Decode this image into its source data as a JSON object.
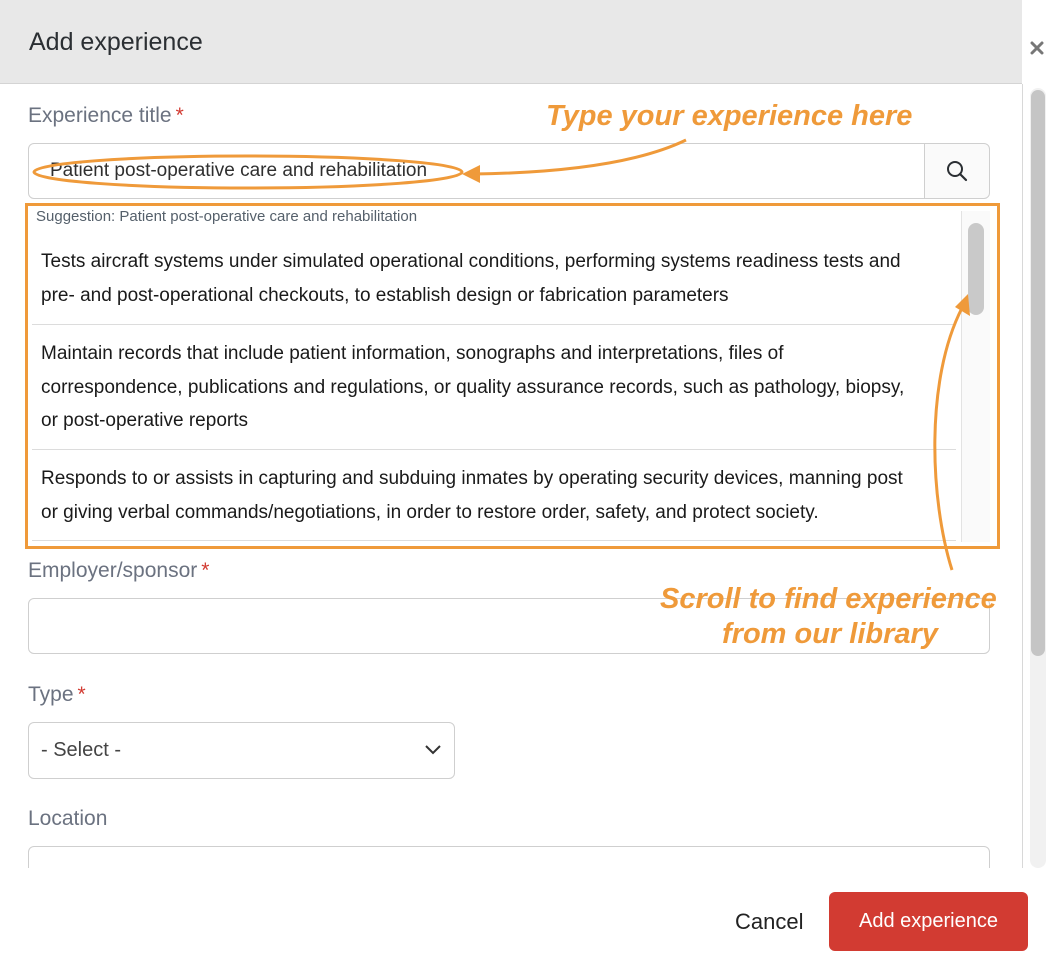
{
  "dialog": {
    "title": "Add experience"
  },
  "form": {
    "experience_title": {
      "label": "Experience title",
      "required_mark": "*",
      "value": "Patient post-operative care and rehabilitation"
    },
    "employer": {
      "label": "Employer/sponsor",
      "required_mark": "*",
      "value": ""
    },
    "type": {
      "label": "Type",
      "required_mark": "*",
      "selected": "- Select -"
    },
    "location": {
      "label": "Location",
      "value": ""
    }
  },
  "suggestions": {
    "header": "Suggestion: Patient post-operative care and rehabilitation",
    "items": [
      {
        "lines": [
          "Tests aircraft systems under simulated operational conditions, performing systems readiness tests and",
          "pre- and post-operational checkouts, to establish design or fabrication parameters"
        ]
      },
      {
        "lines": [
          "Maintain records that include patient information, sonographs and interpretations, files of",
          "correspondence, publications and regulations, or quality assurance records, such as pathology, biopsy,",
          "or post-operative reports"
        ]
      },
      {
        "lines": [
          "Responds to or assists in capturing and subduing inmates by operating security devices, manning post",
          "or giving verbal commands/negotiations, in order to restore order, safety, and protect society."
        ]
      }
    ]
  },
  "annotations": {
    "type_hint": "Type your experience here",
    "scroll_hint_line1": "Scroll to find experience",
    "scroll_hint_line2": "from our library"
  },
  "footer": {
    "cancel_label": "Cancel",
    "add_label": "Add experience"
  },
  "icons": {
    "close": "close-icon",
    "search": "search-icon",
    "dropdown": "chevron-down-icon"
  },
  "colors": {
    "annotation": "#ef9a3a",
    "primary_button": "#d23b32",
    "required": "#d23b32"
  }
}
